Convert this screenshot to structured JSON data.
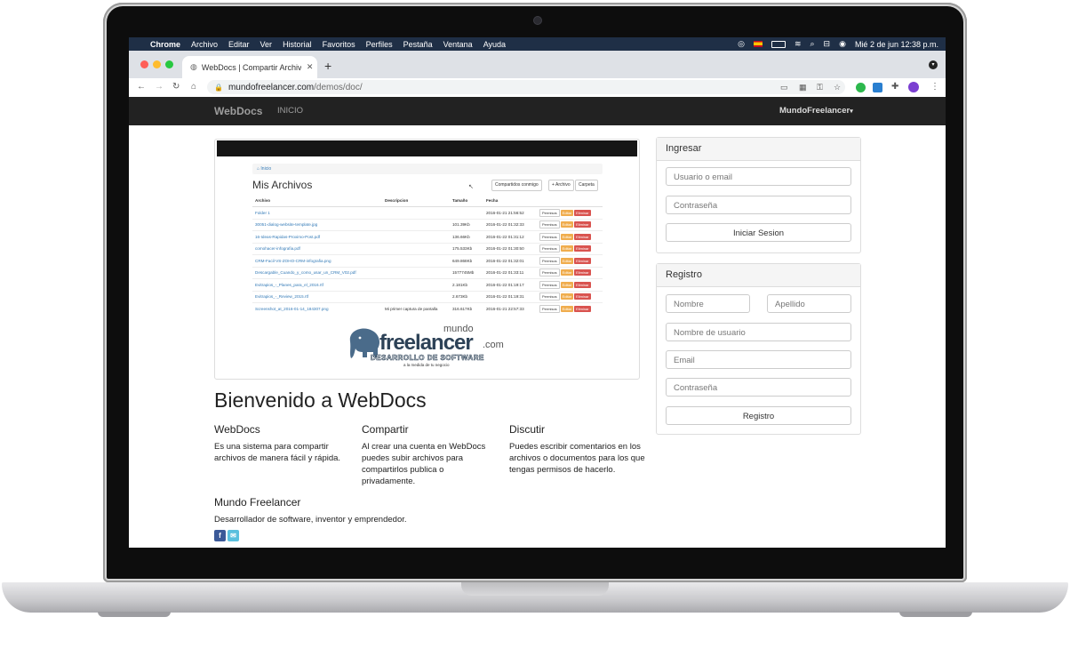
{
  "macos_menubar": {
    "apple_icon": "apple-icon",
    "items": [
      "Chrome",
      "Archivo",
      "Editar",
      "Ver",
      "Historial",
      "Favoritos",
      "Perfiles",
      "Pestaña",
      "Ventana",
      "Ayuda"
    ],
    "clock": "Mié 2 de jun  12:38 p.m."
  },
  "browser": {
    "tab_title": "WebDocs | Compartir Archivos",
    "url_host": "mundofreelancer.com",
    "url_path": "/demos/doc/"
  },
  "navbar": {
    "brand": "WebDocs",
    "link_inicio": "INICIO",
    "user_menu": "MundoFreelancer"
  },
  "preview": {
    "breadcrumb": "Inicio",
    "heading": "Mis Archivos",
    "buttons": [
      "Compartidos conmigo",
      "+ Archivo",
      "Carpeta"
    ],
    "columns": [
      "Archivo",
      "Descripcion",
      "Tamaño",
      "Fecha"
    ],
    "rows": [
      {
        "file": "Folder 1",
        "desc": "",
        "size": "",
        "date": "2016-01-21 21:56:52"
      },
      {
        "file": "30051-dialog-website-template.jpg",
        "desc": "",
        "size": "101.39Kb",
        "date": "2016-01-22 01:32:33"
      },
      {
        "file": "16-Ideas-Rapidas-Proximo-Post.pdf",
        "desc": "",
        "size": "136.66Kb",
        "date": "2016-01-22 01:31:12"
      },
      {
        "file": "comohacer-infografia.pdf",
        "desc": "",
        "size": "175.533Kb",
        "date": "2016-01-22 01:30:50"
      },
      {
        "file": "CRM-Facil-VS-ZOHO-CRM-infografia.png",
        "desc": "",
        "size": "649.868Kb",
        "date": "2016-01-22 01:32:01"
      },
      {
        "file": "Descargable_Cuando_y_como_usar_un_CRM_V02.pdf",
        "desc": "",
        "size": "1577745Mb",
        "date": "2016-01-22 01:33:11"
      },
      {
        "file": "Evitrapios_-_Planes_para_el_2016.rtf",
        "desc": "",
        "size": "2.181Kb",
        "date": "2016-01-22 01:19:17"
      },
      {
        "file": "Evitrapios_-_Review_2015.rtf",
        "desc": "",
        "size": "2.673Kb",
        "date": "2016-01-22 01:19:31"
      },
      {
        "file": "Screenshot_at_2016-01-14_184307.png",
        "desc": "Mi primer captura de pantalla",
        "size": "316.617Kb",
        "date": "2016-01-21 22:57:33"
      }
    ],
    "action_labels": [
      "Permisos",
      "Editar",
      "Eliminar"
    ],
    "logo_top": "mundo",
    "logo_main": "freelancer",
    "logo_suffix": ".com",
    "logo_tag1": "DESARROLLO DE SOFTWARE",
    "logo_tag2": "a la medida de tu negocio"
  },
  "main": {
    "title": "Bienvenido a WebDocs",
    "cols": [
      {
        "heading": "WebDocs",
        "text": [
          "Es una sistema para compartir",
          "archivos de manera fácil y rápida."
        ]
      },
      {
        "heading": "Compartir",
        "text": [
          "Al crear una cuenta en WebDocs",
          "puedes subir archivos para",
          "compartirlos publica o",
          "privadamente."
        ]
      },
      {
        "heading": "Discutir",
        "text": [
          "Puedes escribir comentarios en los",
          "archivos o documentos para los que",
          "tengas permisos de hacerlo."
        ]
      }
    ],
    "about_heading": "Mundo Freelancer",
    "about_text": "Desarrollador de software, inventor y emprendedor.",
    "social": {
      "facebook": "f",
      "email": "✉"
    }
  },
  "login": {
    "title": "Ingresar",
    "user_placeholder": "Usuario o email",
    "pass_placeholder": "Contraseña",
    "submit": "Iniciar Sesion"
  },
  "register": {
    "title": "Registro",
    "first_name": "Nombre",
    "last_name": "Apellido",
    "username": "Nombre de usuario",
    "email": "Email",
    "password": "Contraseña",
    "submit": "Registro"
  },
  "colors": {
    "accent_link": "#337ab7",
    "navbar": "#222222",
    "macos_bar": "#1f2f46"
  }
}
